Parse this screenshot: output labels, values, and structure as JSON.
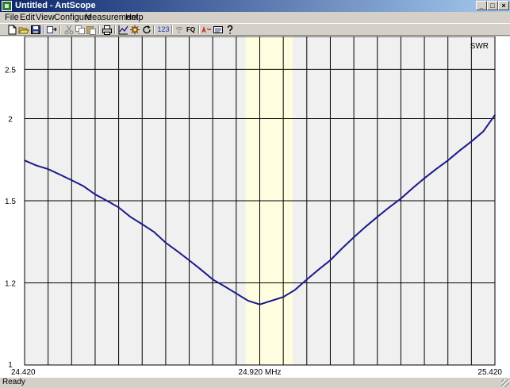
{
  "window": {
    "title": "Untitled - AntScope",
    "controls": {
      "minimize": "_",
      "maximize": "□",
      "close": "×"
    }
  },
  "menu": [
    "File",
    "Edit",
    "View",
    "Configure",
    "Measurement",
    "Help"
  ],
  "toolbar": {
    "items": [
      {
        "id": "new",
        "icon": "new-file-icon"
      },
      {
        "id": "open",
        "icon": "open-folder-icon"
      },
      {
        "id": "save",
        "icon": "save-disk-icon"
      },
      {
        "id": "export",
        "icon": "export-icon"
      },
      {
        "id": "cut",
        "icon": "cut-icon"
      },
      {
        "id": "copy",
        "icon": "copy-icon"
      },
      {
        "id": "paste",
        "icon": "paste-icon"
      },
      {
        "id": "print",
        "icon": "print-icon"
      },
      {
        "id": "chart",
        "icon": "chart-icon"
      },
      {
        "id": "settings",
        "icon": "gear-icon"
      },
      {
        "id": "refresh",
        "icon": "refresh-icon"
      },
      {
        "id": "numbers",
        "icon": "numbers-icon",
        "label": "123"
      },
      {
        "id": "wireless",
        "icon": "wireless-icon"
      },
      {
        "id": "fq",
        "icon": "frequency-icon",
        "label": "FQ"
      },
      {
        "id": "memory",
        "icon": "memory-icon"
      },
      {
        "id": "memory-list",
        "icon": "list-icon"
      },
      {
        "id": "help",
        "icon": "help-icon"
      }
    ]
  },
  "chart_data": {
    "type": "line",
    "series": [
      {
        "name": "SWR",
        "color": "#1a1a8c",
        "x": [
          24.42,
          24.445,
          24.47,
          24.495,
          24.52,
          24.545,
          24.57,
          24.595,
          24.62,
          24.645,
          24.67,
          24.695,
          24.72,
          24.745,
          24.77,
          24.795,
          24.82,
          24.845,
          24.87,
          24.895,
          24.92,
          24.945,
          24.97,
          24.995,
          25.02,
          25.045,
          25.07,
          25.095,
          25.12,
          25.145,
          25.17,
          25.195,
          25.22,
          25.245,
          25.27,
          25.295,
          25.32,
          25.345,
          25.37,
          25.395,
          25.42
        ],
        "y": [
          1.71,
          1.68,
          1.66,
          1.63,
          1.6,
          1.57,
          1.53,
          1.5,
          1.47,
          1.43,
          1.4,
          1.37,
          1.33,
          1.3,
          1.27,
          1.24,
          1.21,
          1.19,
          1.17,
          1.15,
          1.14,
          1.15,
          1.16,
          1.18,
          1.21,
          1.24,
          1.27,
          1.31,
          1.35,
          1.39,
          1.43,
          1.47,
          1.51,
          1.56,
          1.61,
          1.66,
          1.71,
          1.77,
          1.83,
          1.9,
          2.03
        ]
      }
    ],
    "x_ticks": [
      "24.420",
      "24.920 MHz",
      "25.420"
    ],
    "xlim": [
      24.42,
      25.42
    ],
    "y_ticks": [
      1,
      1.2,
      1.5,
      2,
      2.5
    ],
    "y_tick_labels": [
      "1",
      "1.2",
      "1.5",
      "2",
      "2.5"
    ],
    "ylim": [
      1,
      3
    ],
    "y_scale": "reciprocal",
    "grid": true,
    "highlight_band": {
      "from": 24.89,
      "to": 24.99,
      "color": "#fffde0"
    },
    "legend": {
      "label": "SWR",
      "position": "top-right"
    },
    "plot_background": "#f0f0f0",
    "grid_color": "#000000"
  },
  "statusbar": {
    "text": "Ready"
  }
}
